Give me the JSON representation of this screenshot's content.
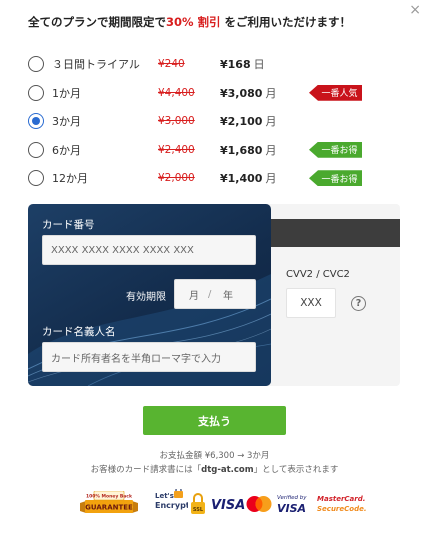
{
  "headline": {
    "prefix": "全てのプランで期間限定で",
    "highlight": "30% 割引",
    "suffix": " をご利用いただけます！"
  },
  "plans": [
    {
      "name": "３日間トライアル",
      "old": "¥240",
      "price": "¥168",
      "unit": "日",
      "checked": false,
      "tag": ""
    },
    {
      "name": "1か月",
      "old": "¥4,400",
      "price": "¥3,080",
      "unit": "月",
      "checked": false,
      "tag": "一番人気"
    },
    {
      "name": "3か月",
      "old": "¥3,000",
      "price": "¥2,100",
      "unit": "月",
      "checked": true,
      "tag": ""
    },
    {
      "name": "6か月",
      "old": "¥2,400",
      "price": "¥1,680",
      "unit": "月",
      "checked": false,
      "tag": "一番お得"
    },
    {
      "name": "12か月",
      "old": "¥2,000",
      "price": "¥1,400",
      "unit": "月",
      "checked": false,
      "tag": "一番お得"
    }
  ],
  "card": {
    "number_label": "カード番号",
    "number_placeholder": "XXXX XXXX XXXX XXXX XXX",
    "expiry_label": "有効期限",
    "month_placeholder": "月",
    "separator": "/",
    "year_placeholder": "年",
    "holder_label": "カード名義人名",
    "holder_placeholder": "カード所有者名を半角ローマ字で入力"
  },
  "cvv": {
    "label": "CVV2 / CVC2",
    "placeholder": "XXX",
    "help": "?"
  },
  "pay_button": "支払う",
  "summary": {
    "line1": "お支払金額 ¥6,300 → 3か月",
    "line2_prefix": "お客様のカード請求書には「",
    "line2_merchant": "dtg-at.com",
    "line2_suffix": "」として表示されます"
  },
  "badges": {
    "guarantee_top": "100% Money Back",
    "guarantee_main": "GUARANTEE",
    "letsencrypt_top": "Let's",
    "letsencrypt_bottom": "Encrypt",
    "ssl": "SSL",
    "visa": "VISA",
    "verified_top": "Verified by",
    "verified_bottom": "VISA",
    "mc_top": "MasterCard.",
    "mc_bottom": "SecureCode."
  },
  "colors": {
    "accent_red": "#d81e1e",
    "radio_blue": "#2a6bd1",
    "pay_green": "#58b430",
    "tag_red": "#c9131b",
    "tag_green": "#4aa92e",
    "card_navy": "#132c4c"
  },
  "icons": {
    "close": "close-icon",
    "help": "help-circle-icon"
  }
}
